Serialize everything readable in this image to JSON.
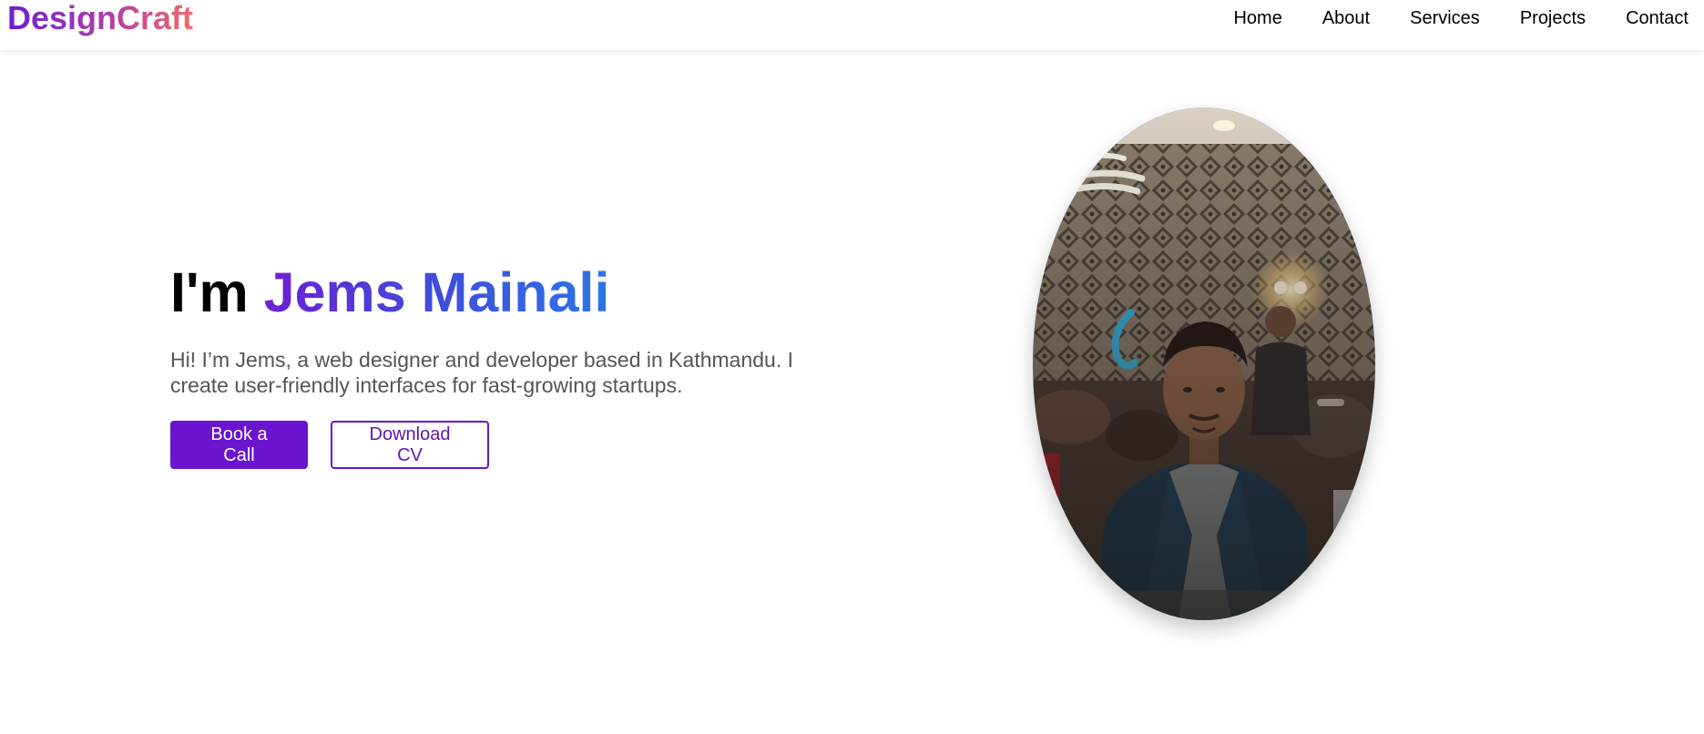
{
  "header": {
    "logo": "DesignCraft",
    "nav": [
      "Home",
      "About",
      "Services",
      "Projects",
      "Contact"
    ]
  },
  "hero": {
    "title_prefix": "I'm",
    "name": "Jems Mainali",
    "intro": "Hi! I’m Jems, a web designer and developer based in Kathmandu. I create user-friendly interfaces for fast-growing startups.",
    "primary_button": "Book a Call",
    "secondary_button": "Download CV"
  },
  "colors": {
    "accent": "#6a14cf",
    "name_gradient_start": "#6f1fd4",
    "name_gradient_end": "#2e74e8",
    "logo_gradient_start": "#6a21d6",
    "logo_gradient_end": "#ee6b6b",
    "body_text": "#555555"
  }
}
